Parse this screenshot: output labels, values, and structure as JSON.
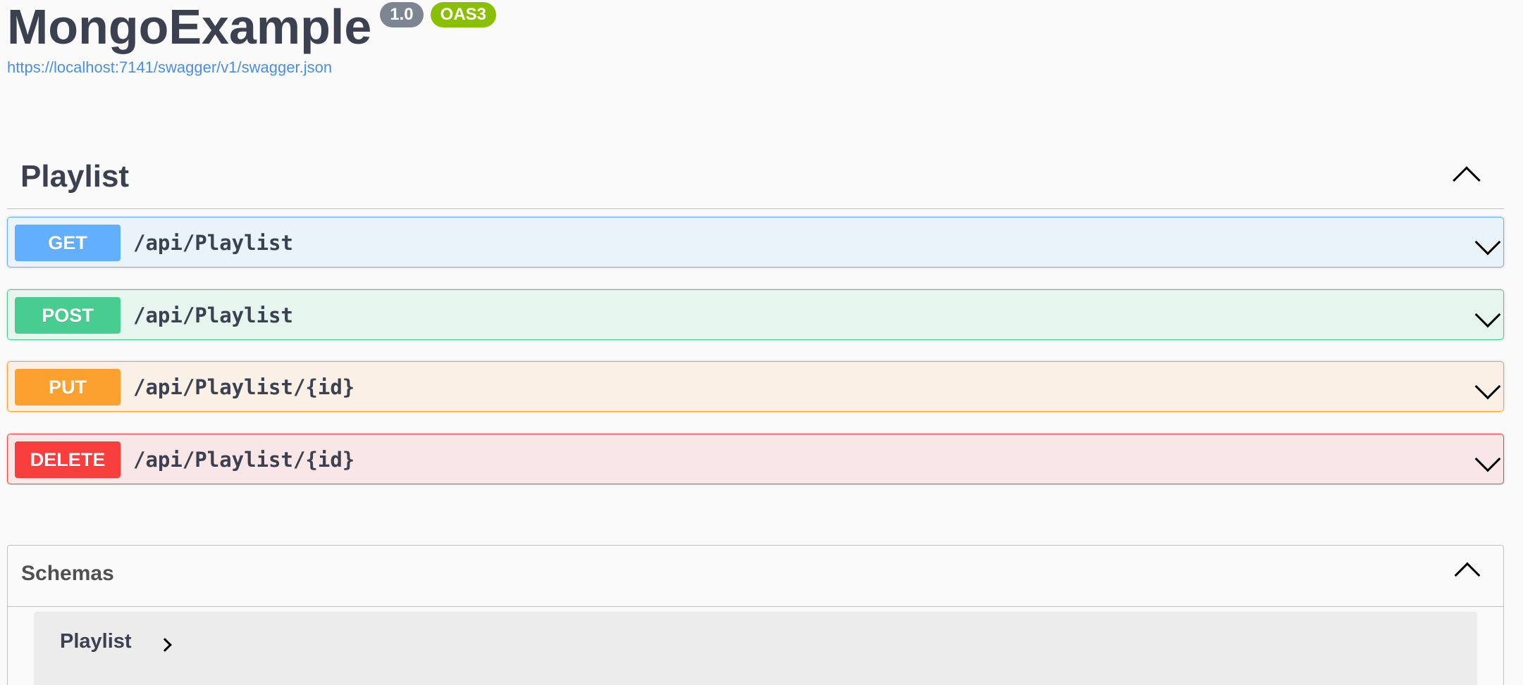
{
  "header": {
    "title": "MongoExample",
    "version": "1.0",
    "oas_badge": "OAS3",
    "spec_url": "https://localhost:7141/swagger/v1/swagger.json"
  },
  "tag": {
    "name": "Playlist",
    "toggle_icon": "chevron-up-icon"
  },
  "operations": [
    {
      "method": "GET",
      "path": "/api/Playlist",
      "color": "#61affe"
    },
    {
      "method": "POST",
      "path": "/api/Playlist",
      "color": "#49cc90"
    },
    {
      "method": "PUT",
      "path": "/api/Playlist/{id}",
      "color": "#fca130"
    },
    {
      "method": "DELETE",
      "path": "/api/Playlist/{id}",
      "color": "#f93e3e"
    }
  ],
  "schemas": {
    "title": "Schemas",
    "toggle_icon": "chevron-up-icon",
    "models": [
      {
        "name": "Playlist",
        "toggle_icon": "chevron-right-icon"
      }
    ]
  }
}
